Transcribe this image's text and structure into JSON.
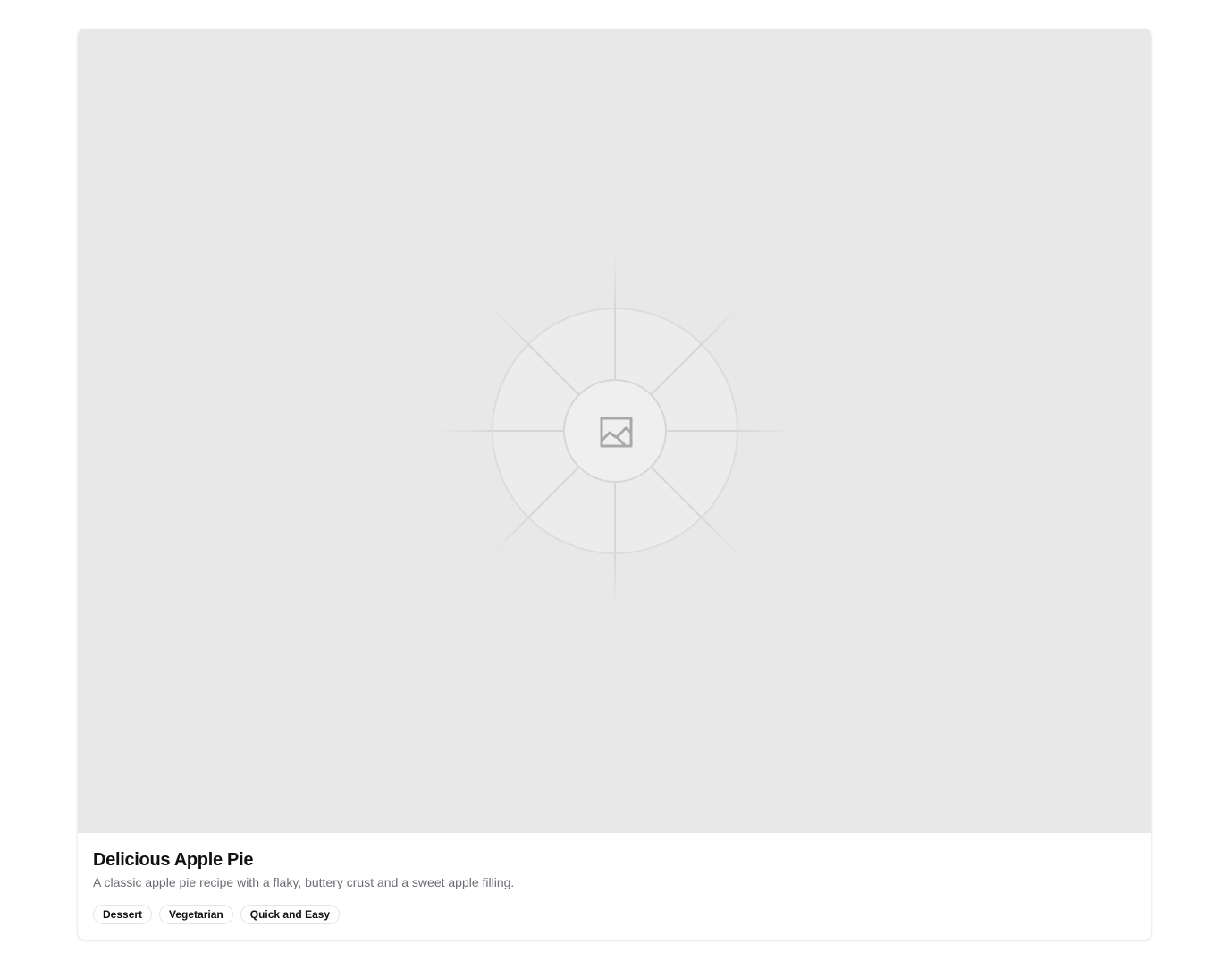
{
  "card": {
    "image": {
      "icon": "image-icon",
      "background": "#e8e8e8"
    },
    "title": "Delicious Apple Pie",
    "description": "A classic apple pie recipe with a flaky, buttery crust and a sweet apple filling.",
    "tags": [
      {
        "label": "Dessert"
      },
      {
        "label": "Vegetarian"
      },
      {
        "label": "Quick and Easy"
      }
    ]
  }
}
